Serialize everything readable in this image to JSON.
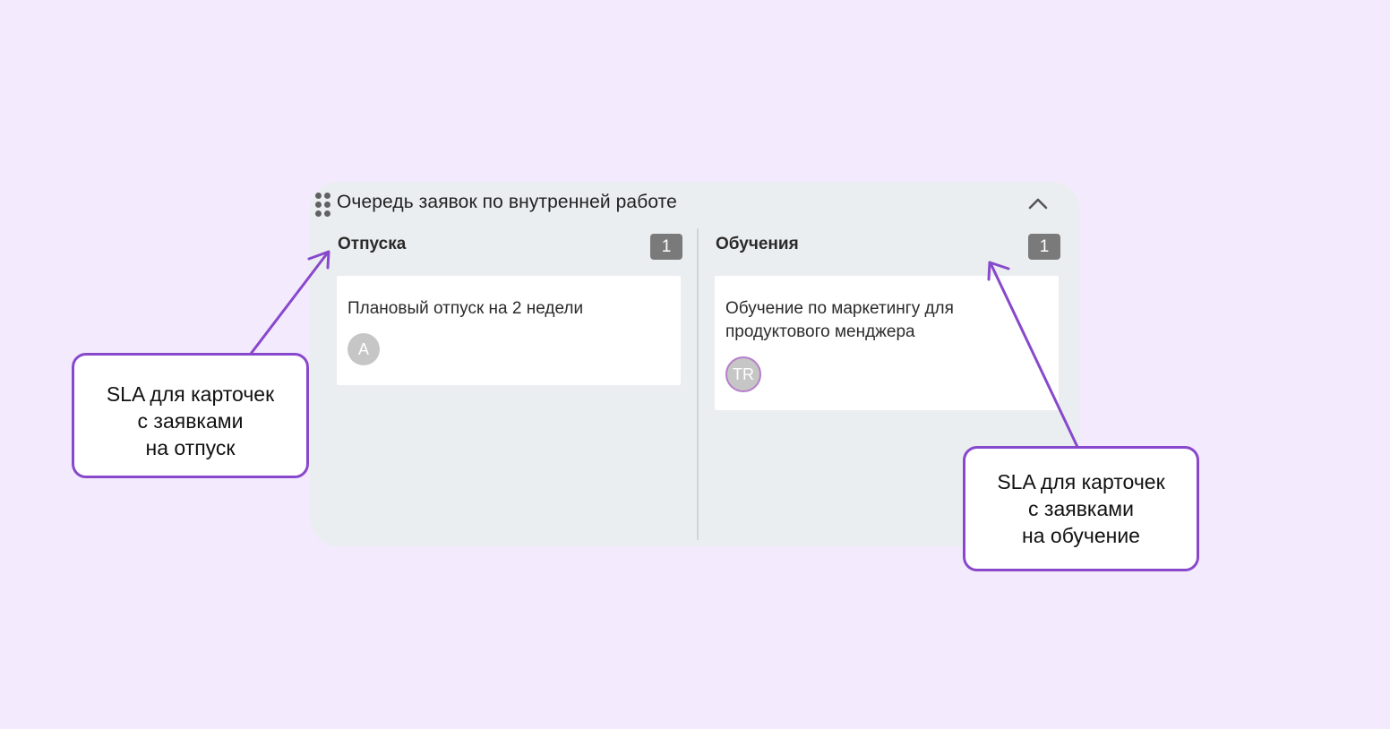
{
  "board": {
    "title": "Очередь заявок по внутренней работе",
    "columns": [
      {
        "title": "Отпуска",
        "count": "1",
        "card": {
          "title": "Плановый отпуск на 2 недели",
          "avatar": "A"
        }
      },
      {
        "title": "Обучения",
        "count": "1",
        "card": {
          "title": "Обучение по маркетингу для продуктового менджера",
          "avatar": "TR"
        }
      }
    ]
  },
  "callouts": {
    "left": [
      "SLA для карточек",
      "с заявками",
      "на отпуск"
    ],
    "right": [
      "SLA для карточек",
      "с заявками",
      "на обучение"
    ]
  },
  "icons": {
    "drag": "drag-handle-icon",
    "collapse": "chevron-up-icon"
  },
  "colors": {
    "background": "#f4eafd",
    "board": "#ebeef0",
    "accent": "#8848cc",
    "badge": "#7a7a7a"
  }
}
